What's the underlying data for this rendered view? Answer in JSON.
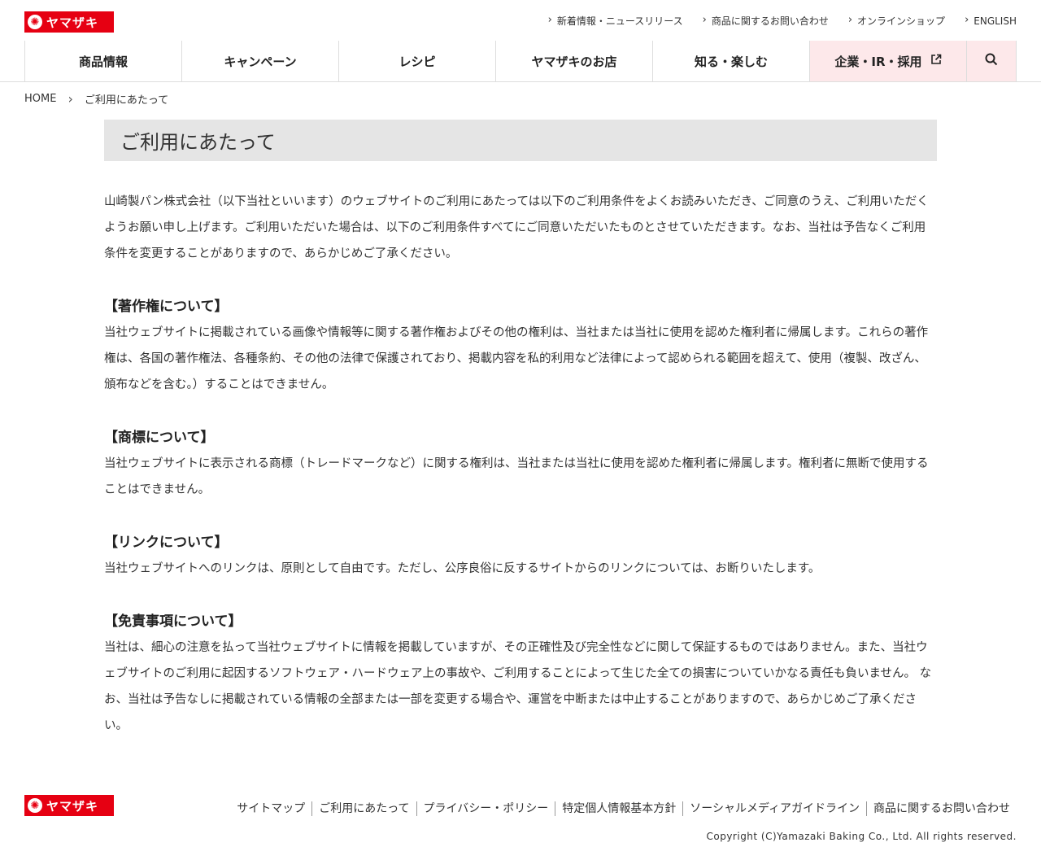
{
  "brand": {
    "logo_icon": "ヤマザキ-sun-mark-icon",
    "logo_text": "ヤマザキ",
    "accent_color": "#e60012",
    "accent_bg": "#fde8ea"
  },
  "util_links": [
    {
      "label": "新着情報・ニュースリリース"
    },
    {
      "label": "商品に関するお問い合わせ"
    },
    {
      "label": "オンラインショップ"
    },
    {
      "label": "ENGLISH"
    }
  ],
  "nav": [
    {
      "label": "商品情報"
    },
    {
      "label": "キャンペーン"
    },
    {
      "label": "レシピ"
    },
    {
      "label": "ヤマザキのお店"
    },
    {
      "label": "知る・楽しむ"
    },
    {
      "label": "企業・IR・採用",
      "icon": "external-link-icon"
    }
  ],
  "nav_search_icon": "search-icon",
  "breadcrumb": {
    "home": "HOME",
    "current": "ご利用にあたって"
  },
  "page": {
    "title": "ご利用にあたって",
    "intro": "山崎製パン株式会社（以下当社といいます）のウェブサイトのご利用にあたっては以下のご利用条件をよくお読みいただき、ご同意のうえ、ご利用いただくようお願い申し上げます。ご利用いただいた場合は、以下のご利用条件すべてにご同意いただいたものとさせていただきます。なお、当社は予告なくご利用条件を変更することがありますので、あらかじめご了承ください。",
    "sections": [
      {
        "heading": "【著作権について】",
        "body": "当社ウェブサイトに掲載されている画像や情報等に関する著作権およびその他の権利は、当社または当社に使用を認めた権利者に帰属します。これらの著作権は、各国の著作権法、各種条約、その他の法律で保護されており、掲載内容を私的利用など法律によって認められる範囲を超えて、使用（複製、改ざん、頒布などを含む。）することはできません。"
      },
      {
        "heading": "【商標について】",
        "body": "当社ウェブサイトに表示される商標（トレードマークなど）に関する権利は、当社または当社に使用を認めた権利者に帰属します。権利者に無断で使用することはできません。"
      },
      {
        "heading": "【リンクについて】",
        "body": "当社ウェブサイトへのリンクは、原則として自由です。ただし、公序良俗に反するサイトからのリンクについては、お断りいたします。"
      },
      {
        "heading": "【免責事項について】",
        "body": "当社は、細心の注意を払って当社ウェブサイトに情報を掲載していますが、その正確性及び完全性などに関して保証するものではありません。また、当社ウェブサイトのご利用に起因するソフトウェア・ハードウェア上の事故や、ご利用することによって生じた全ての損害についていかなる責任も負いません。 なお、当社は予告なしに掲載されている情報の全部または一部を変更する場合や、運営を中断または中止することがありますので、あらかじめご了承ください。"
      }
    ]
  },
  "footer": {
    "links": [
      {
        "label": "サイトマップ"
      },
      {
        "label": "ご利用にあたって"
      },
      {
        "label": "プライバシー・ポリシー"
      },
      {
        "label": "特定個人情報基本方針"
      },
      {
        "label": "ソーシャルメディアガイドライン"
      },
      {
        "label": "商品に関するお問い合わせ"
      }
    ],
    "copyright": "Copyright (C)Yamazaki Baking Co., Ltd. All rights reserved."
  }
}
